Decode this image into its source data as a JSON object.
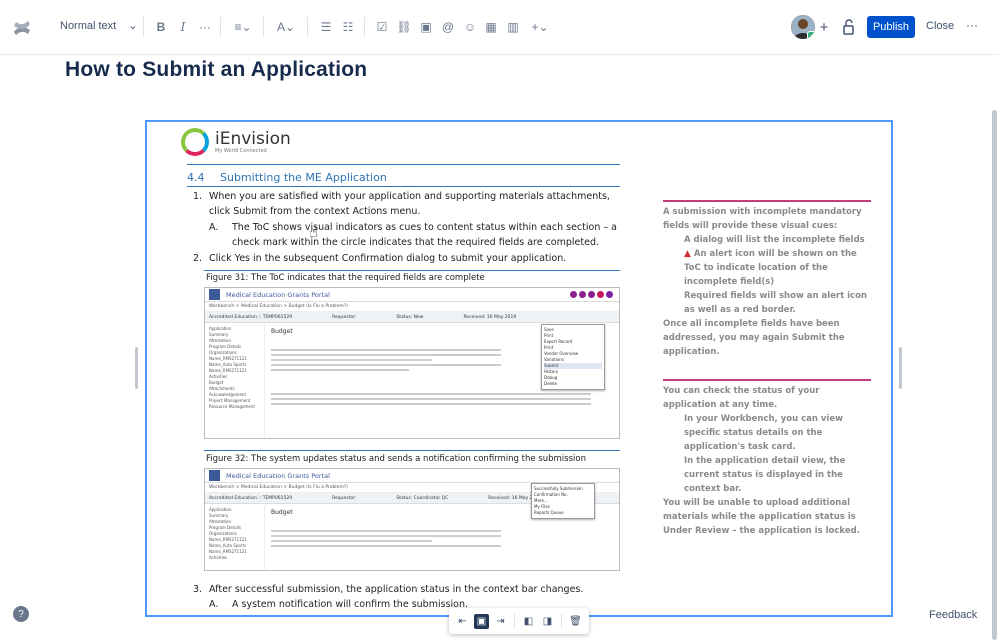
{
  "toolbar": {
    "text_style": "Normal text",
    "icons": [
      "bold-icon",
      "italic-icon",
      "more-formatting-icon",
      "align-icon",
      "text-color-icon",
      "bullet-list-icon",
      "numbered-list-icon",
      "task-icon",
      "link-icon",
      "image-icon",
      "mention-icon",
      "emoji-icon",
      "table-icon",
      "layout-icon",
      "insert-icon"
    ],
    "publish_label": "Publish",
    "close_label": "Close",
    "more_label": "···"
  },
  "page": {
    "title": "How to Submit an Application"
  },
  "embedded_doc": {
    "logo_name": "iEnvision",
    "logo_tagline": "My World Connected",
    "section_number": "4.4",
    "section_title": "Submitting the ME Application",
    "steps": [
      {
        "num": "1.",
        "text": "When you are satisfied with your application and supporting materials attachments, click Submit from the context Actions menu."
      },
      {
        "num": "A.",
        "text": "The ToC shows visual indicators as cues to content status within each section – a check mark within the circle indicates that the required fields are completed."
      },
      {
        "num": "2.",
        "text": "Click Yes in the subsequent Confirmation dialog to submit your application."
      },
      {
        "num": "3.",
        "text": "After successful submission, the application status in the context bar changes."
      },
      {
        "num": "A.",
        "text": "A system notification will confirm the submission."
      }
    ],
    "figure31_caption": "Figure 31: The ToC indicates that the required fields are complete",
    "figure32_caption": "Figure 32: The system updates status and sends a notification confirming the submission",
    "shot": {
      "portal_title": "Medical Education Grants Portal",
      "crumb": "Workbench  >  Medical Education  >  Budget (Is Flu a Problem?)",
      "ctx1": [
        "Accredited Education :: TEMP061529",
        "Requestor:",
        "Status: New",
        "Received: 16 May 2019"
      ],
      "ctx2": [
        "Accredited Education :: TEMP061529",
        "Requestor:",
        "Status: Coordinator QC",
        "Received: 16 May 2019"
      ],
      "side_items": [
        "Application",
        "Summary",
        "Attestation",
        "Program Details",
        "Organizations",
        "Name_RMS271121",
        "Name_Auto Sports",
        "Name_RMS271121",
        "Activities",
        "Budget",
        "Attachments",
        "Acknowledgement",
        "Project Management",
        "Resource Management"
      ],
      "budget_label": "Budget",
      "menu1": [
        "Save",
        "Print",
        "Export Record",
        "Print",
        "Vendor Overview",
        "Variations",
        "Submit",
        "History",
        "Debug",
        "Delete"
      ],
      "menu2": [
        "Successfully Submission",
        "Confirmation No.",
        "More...",
        "My Files",
        "Reports Queue"
      ]
    },
    "side_note_1": {
      "lead": "A submission with incomplete mandatory fields will provide these visual cues:",
      "bullets": [
        "A dialog will list the incomplete fields",
        "An alert  icon will be shown on the ToC to indicate location of the incomplete field(s)",
        "Required fields will show an alert icon as well as a red border."
      ],
      "tail": "Once all incomplete fields have been addressed, you may again Submit the application."
    },
    "side_note_2": {
      "lead": "You can check the status of your application at any time.",
      "bullets": [
        "In your Workbench, you can view specific status details on the application's task card.",
        "In the application detail view, the current status is displayed in the context bar."
      ],
      "tail": "You will be unable to upload additional materials while the application status is Under Review – the application is locked."
    }
  },
  "image_toolbar": {
    "icons": [
      "align-left-icon",
      "align-center-icon",
      "align-right-icon",
      "wrap-left-icon",
      "wrap-right-icon",
      "delete-icon"
    ]
  },
  "footer": {
    "help_label": "?",
    "feedback_label": "Feedback"
  },
  "colors": {
    "publish": "#0052cc",
    "selection": "#4c9aff",
    "doc_heading": "#2e74b5",
    "note_rule": "#c0407a"
  }
}
